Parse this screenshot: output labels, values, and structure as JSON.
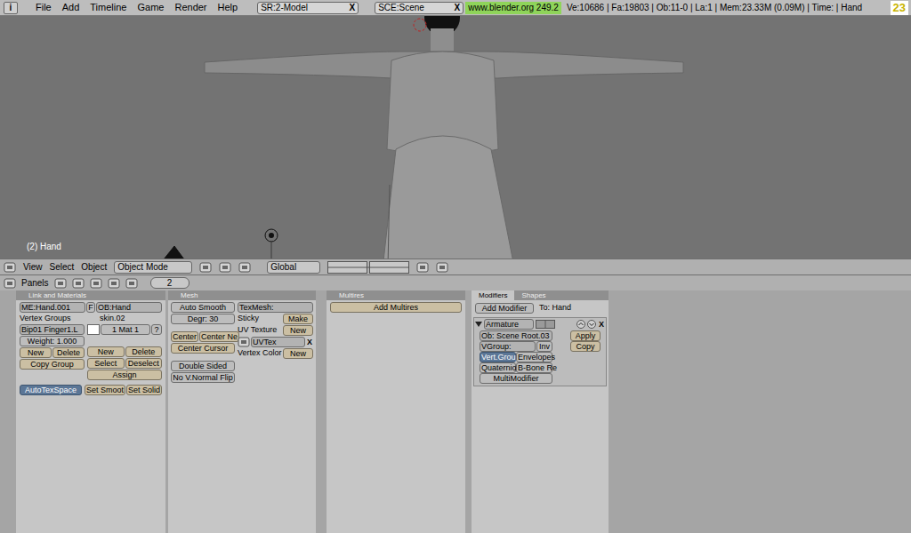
{
  "menubar": {
    "info_glyph": "i",
    "menus": [
      "File",
      "Add",
      "Timeline",
      "Game",
      "Render",
      "Help"
    ],
    "screen": "SR:2-Model",
    "scene": "SCE:Scene",
    "close_glyph": "X",
    "url": "www.blender.org 249.2",
    "stats": "Ve:10686 | Fa:19803 | Ob:11-0 | La:1 | Mem:23.33M (0.09M) | Time: | Hand",
    "corner_badge": "23"
  },
  "viewport": {
    "object_label": "(2) Hand"
  },
  "viewport_header": {
    "menus": [
      "View",
      "Select",
      "Object"
    ],
    "mode": "Object Mode",
    "orientation": "Global"
  },
  "buttons_header": {
    "label": "Panels",
    "frame": "2"
  },
  "link_panel": {
    "title": "Link and Materials",
    "mesh_name": "ME:Hand.001",
    "f_button": "F",
    "object_name": "OB:Hand",
    "vertex_groups_label": "Vertex Groups",
    "material_name": "skin.02",
    "vertex_group": "Bip01 Finger1.L",
    "weight": "Weight: 1.000",
    "group_buttons": [
      "New",
      "Delete"
    ],
    "copy_group": "Copy Group",
    "material_slot": "1 Mat 1",
    "material_help": "?",
    "material_buttons": [
      "New",
      "Delete",
      "Select",
      "Deselect",
      "Assign"
    ],
    "bottom_buttons": [
      {
        "label": "AutoTexSpace",
        "selected": true
      },
      {
        "label": "Set Smoot",
        "selected": false
      },
      {
        "label": "Set Solid",
        "selected": false
      }
    ]
  },
  "mesh_panel": {
    "title": "Mesh",
    "auto_smooth": "Auto Smooth",
    "degree": "Degr: 30",
    "center_buttons": [
      "Center",
      "Center Ne"
    ],
    "center_cursor": "Center Cursor",
    "double_sided": "Double Sided",
    "normal_flip": "No V.Normal Flip",
    "texmesh": "TexMesh:",
    "sticky": "Sticky",
    "sticky_button": "Make",
    "uv_texture": "UV Texture",
    "uv_button": "New",
    "uv_name": "UVTex",
    "uv_close": "X",
    "vertex_color": "Vertex Color",
    "vertex_color_button": "New"
  },
  "multires_panel": {
    "title": "Multires",
    "button": "Add Multires"
  },
  "modifiers_panel": {
    "tabs": [
      {
        "label": "Modifiers",
        "selected": true
      },
      {
        "label": "Shapes",
        "selected": false
      }
    ],
    "add_button": "Add Modifier",
    "target": "To: Hand",
    "modifier": {
      "expanded": true,
      "name": "Armature",
      "close_glyph": "X",
      "object": "Ob: Scene Root.03",
      "vgroup": "VGroup:",
      "invert": "Inv",
      "options": [
        {
          "label": "Vert.Group",
          "selected": true
        },
        {
          "label": "Envelopes",
          "selected": false
        },
        {
          "label": "Quaternion",
          "selected": false
        },
        {
          "label": "B-Bone Re",
          "selected": false
        }
      ],
      "multi": "MultiModifier",
      "actions": [
        "Apply",
        "Copy"
      ]
    }
  }
}
